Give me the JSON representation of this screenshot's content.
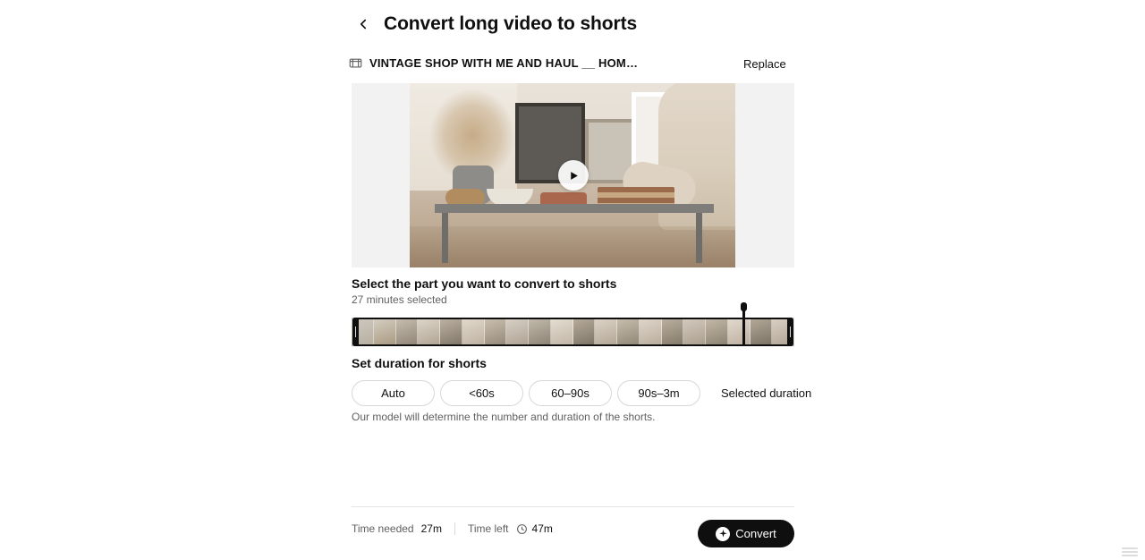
{
  "header": {
    "back_icon": "chevron-left-icon",
    "title": "Convert long video to shorts"
  },
  "video": {
    "icon": "video-file-icon",
    "name": "VINTAGE SHOP WITH ME AND HAUL __ HOM…",
    "replace_label": "Replace",
    "play_icon": "play-icon"
  },
  "select_section": {
    "title": "Select the part you want to convert to shorts",
    "subtitle": "27 minutes selected"
  },
  "duration_section": {
    "title": "Set duration for shorts",
    "options": [
      {
        "label": "Auto",
        "selected": false
      },
      {
        "label": "<60s",
        "selected": false
      },
      {
        "label": "60–90s",
        "selected": false
      },
      {
        "label": "90s–3m",
        "selected": false
      },
      {
        "label": "Selected duration",
        "selected": true
      }
    ],
    "helper": "Our model will determine the number and duration of the shorts."
  },
  "footer": {
    "time_needed_label": "Time needed",
    "time_needed_value": "27m",
    "time_left_label": "Time left",
    "time_left_value": "47m",
    "time_left_icon": "clock-icon",
    "convert_label": "Convert",
    "convert_icon": "sparkle-icon"
  },
  "colors": {
    "accent": "#0f0f0f",
    "muted": "#606060",
    "border": "#d8d8d8"
  }
}
